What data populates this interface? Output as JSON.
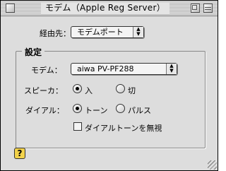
{
  "window": {
    "title": "モデム（Apple Reg Server）"
  },
  "connection": {
    "label": "経由先：",
    "value": "モデムポート"
  },
  "settings": {
    "group_title": "設定",
    "modem_label": "モデム：",
    "modem_value": "aiwa PV-PF288",
    "speaker_label": "スピーカ：",
    "speaker_on": "入",
    "speaker_off": "切",
    "speaker_selected": "入",
    "dial_label": "ダイアル：",
    "dial_tone": "トーン",
    "dial_pulse": "パルス",
    "dial_selected": "トーン",
    "ignore_dial_tone": "ダイアルトーンを無視",
    "ignore_dial_tone_checked": false
  },
  "help": {
    "icon": "?"
  }
}
